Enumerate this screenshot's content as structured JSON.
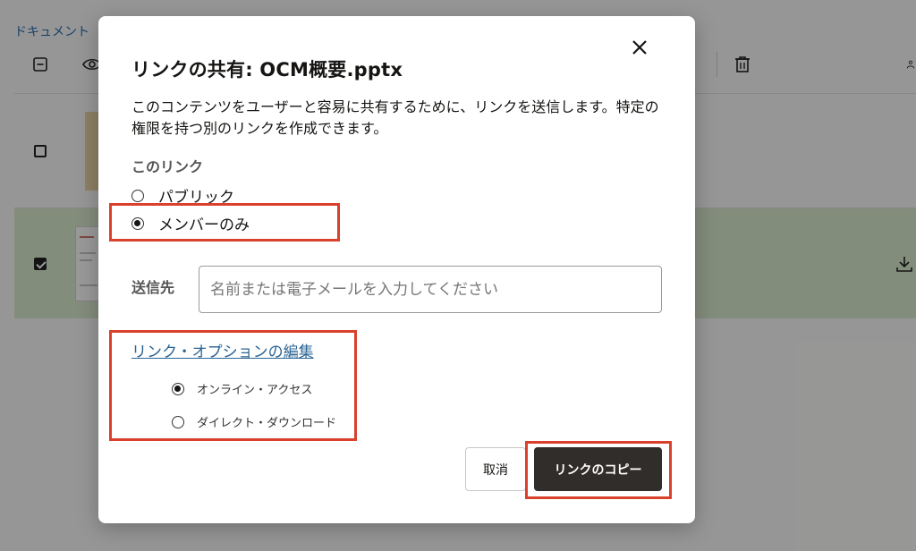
{
  "background": {
    "breadcrumb": "ドキュメント",
    "icons": [
      "collapse-icon",
      "eye-icon",
      "trash-icon",
      "download-icon"
    ]
  },
  "dialog": {
    "title": "リンクの共有: OCM概要.pptx",
    "description": "このコンテンツをユーザーと容易に共有するために、リンクを送信します。特定の権限を持つ別のリンクを作成できます。",
    "link_section_label": "このリンク",
    "link_options": [
      {
        "label": "パブリック",
        "selected": false
      },
      {
        "label": "メンバーのみ",
        "selected": true
      }
    ],
    "recipient": {
      "label": "送信先",
      "placeholder": "名前または電子メールを入力してください",
      "value": ""
    },
    "edit_options_link": "リンク・オプションの編集",
    "access_options": [
      {
        "label": "オンライン・アクセス",
        "selected": true
      },
      {
        "label": "ダイレクト・ダウンロード",
        "selected": false
      }
    ],
    "buttons": {
      "cancel": "取消",
      "copy": "リンクのコピー"
    }
  },
  "colors": {
    "primary_button": "#312d2a",
    "link": "#2a6496",
    "highlight": "#d9412d",
    "selected_row": "#dbeccf"
  }
}
